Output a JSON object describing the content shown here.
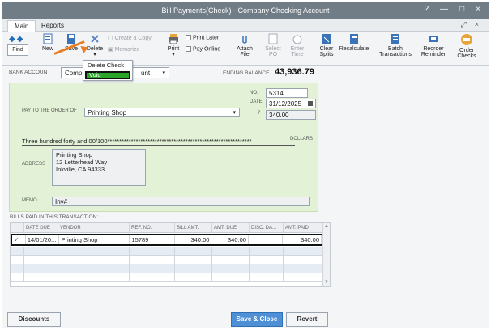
{
  "window": {
    "title": "Bill Payments(Check) - Company Checking Account",
    "help_icon": "?",
    "minimize_icon": "—",
    "maximize_icon": "□",
    "close_icon": "×"
  },
  "tabs": {
    "main": "Main",
    "reports": "Reports"
  },
  "toolbar": {
    "find": "Find",
    "new": "New",
    "save": "Save",
    "delete": "Delete",
    "create_copy": "Create a Copy",
    "memorize": "Memorize",
    "print": "Print",
    "print_later": "Print Later",
    "pay_online": "Pay Online",
    "attach_file_1": "Attach",
    "attach_file_2": "File",
    "select_po_1": "Select",
    "select_po_2": "PO",
    "enter_time_1": "Enter",
    "enter_time_2": "Time",
    "clear_splits_1": "Clear",
    "clear_splits_2": "Splits",
    "recalculate": "Recalculate",
    "batch_1": "Batch",
    "batch_2": "Transactions",
    "reorder_1": "Reorder",
    "reorder_2": "Reminder",
    "order_checks_1": "Order",
    "order_checks_2": "Checks"
  },
  "delete_menu": {
    "delete_check": "Delete Check",
    "void": "Void"
  },
  "bank": {
    "label": "BANK ACCOUNT",
    "value": "Comp",
    "value_tail": "unt",
    "ending_label": "ENDING BALANCE",
    "ending_value": "43,936.79"
  },
  "check": {
    "no_label": "NO.",
    "no_value": "5314",
    "date_label": "DATE",
    "date_value": "31/12/2025",
    "amount_label": "?",
    "amount_value": "340.00",
    "pay_to_label": "PAY TO THE ORDER OF",
    "payee": "Printing Shop",
    "amount_words": "Three hundred forty and 00/100*************************************************************",
    "dollars_label": "DOLLARS",
    "address_label": "ADDRESS",
    "address_lines": [
      "Printing Shop",
      "12 Letterhead Way",
      "Inkville, CA 94333"
    ],
    "memo_label": "MEMO",
    "memo_value": "Inv#"
  },
  "bills": {
    "section_label": "BILLS PAID IN THIS TRANSACTION:",
    "columns": [
      "",
      "DATE DUE",
      "VENDOR",
      "REF. NO.",
      "BILL AMT.",
      "AMT. DUE",
      "DISC. DA...",
      "AMT. PAID"
    ],
    "rows": [
      {
        "check": "✓",
        "date_due": "14/01/20...",
        "vendor": "Printing Shop",
        "ref_no": "15789",
        "bill_amt": "340.00",
        "amt_due": "340.00",
        "disc": "",
        "amt_paid": "340.00"
      }
    ]
  },
  "footer": {
    "discounts": "Discounts",
    "save_close": "Save & Close",
    "revert": "Revert"
  },
  "colors": {
    "titlebar": "#707c86",
    "check_bg": "#e3f2d6",
    "accent": "#4f8fd6",
    "void_highlight": "#2aa52a",
    "arrow": "#e87d22"
  }
}
